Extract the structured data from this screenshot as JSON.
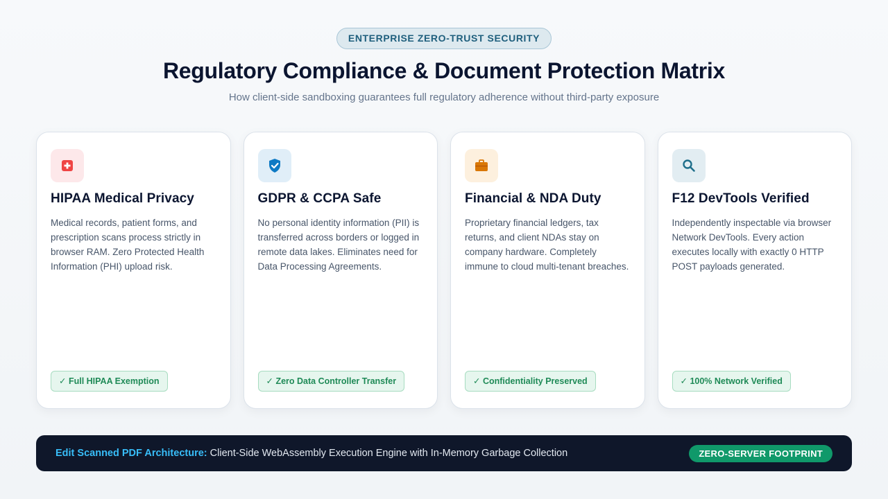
{
  "header": {
    "eyebrow": "ENTERPRISE ZERO-TRUST SECURITY",
    "title": "Regulatory Compliance & Document Protection Matrix",
    "subtitle": "How client-side sandboxing guarantees full regulatory adherence without third-party exposure"
  },
  "cards": [
    {
      "icon": "medical-cross-icon",
      "icon_color": "#ef4444",
      "title": "HIPAA Medical Privacy",
      "text": "Medical records, patient forms, and prescription scans process strictly in browser RAM. Zero Protected Health Information (PHI) upload risk.",
      "badge": "✓ Full HIPAA Exemption"
    },
    {
      "icon": "shield-check-icon",
      "icon_color": "#0e7ac4",
      "title": "GDPR & CCPA Safe",
      "text": "No personal identity information (PII) is transferred across borders or logged in remote data lakes. Eliminates need for Data Processing Agreements.",
      "badge": "✓ Zero Data Controller Transfer"
    },
    {
      "icon": "briefcase-icon",
      "icon_color": "#d97706",
      "title": "Financial & NDA Duty",
      "text": "Proprietary financial ledgers, tax returns, and client NDAs stay on company hardware. Completely immune to cloud multi-tenant breaches.",
      "badge": "✓ Confidentiality Preserved"
    },
    {
      "icon": "magnifier-icon",
      "icon_color": "#1f6f8b",
      "title": "F12 DevTools Verified",
      "text": "Independently inspectable via browser Network DevTools. Every action executes locally with exactly 0 HTTP POST payloads generated.",
      "badge": "✓ 100% Network Verified"
    }
  ],
  "footer": {
    "label": "Edit Scanned PDF Architecture:",
    "text": " Client-Side WebAssembly Execution Engine with In-Memory Garbage Collection",
    "pill": "ZERO-SERVER FOOTPRINT"
  },
  "colors": {
    "accent_blue": "#38bdf8",
    "success_green": "#1f8a57",
    "footer_bg": "#0f172a"
  }
}
